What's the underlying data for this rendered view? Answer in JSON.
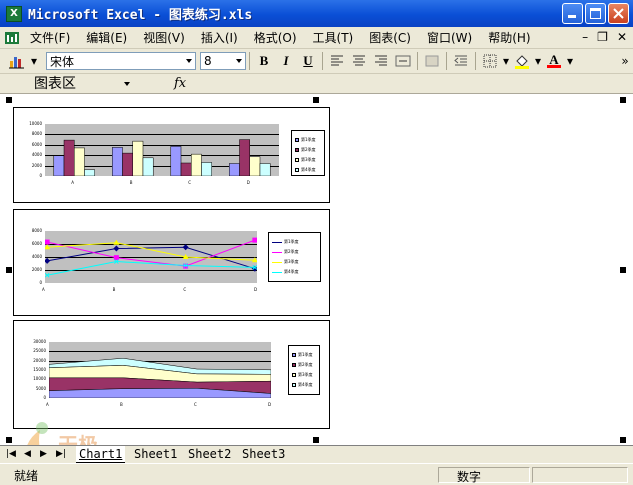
{
  "window": {
    "title": "Microsoft Excel - 图表练习.xls",
    "app_icon_letter": "X"
  },
  "menu": [
    "文件(F)",
    "编辑(E)",
    "视图(V)",
    "插入(I)",
    "格式(O)",
    "工具(T)",
    "图表(C)",
    "窗口(W)",
    "帮助(H)"
  ],
  "toolbar": {
    "font_name": "宋体",
    "font_size": "8",
    "bold": "B",
    "italic": "I",
    "underline": "U",
    "font_color_letter": "A"
  },
  "formula_bar": {
    "name_box": "图表区",
    "fx": "fx"
  },
  "sheet_tabs": [
    "Chart1",
    "Sheet1",
    "Sheet2",
    "Sheet3"
  ],
  "status": {
    "left": "就绪",
    "right": "数字"
  },
  "watermark": "天极",
  "colors": {
    "titlebar": "#0a4fd6",
    "series1": "#9999ff",
    "series2": "#993366",
    "series3": "#ffffcc",
    "series4": "#ccffff",
    "line1": "#000080",
    "line2": "#ff00ff",
    "line3": "#ffff00",
    "line4": "#00ffff"
  },
  "chart_data": [
    {
      "type": "bar",
      "categories": [
        "A",
        "B",
        "C",
        "D"
      ],
      "ylim": [
        0,
        10000
      ],
      "yticks": [
        "10000",
        "8000",
        "6000",
        "4000",
        "2000",
        "0"
      ],
      "series": [
        {
          "name": "第1季度",
          "values": [
            3900,
            5500,
            5700,
            2400
          ]
        },
        {
          "name": "第2季度",
          "values": [
            6900,
            4400,
            2500,
            7000
          ]
        },
        {
          "name": "第3季度",
          "values": [
            5400,
            6700,
            4200,
            3700
          ]
        },
        {
          "name": "第4季度",
          "values": [
            1200,
            3500,
            2600,
            2400
          ]
        }
      ]
    },
    {
      "type": "line",
      "categories": [
        "A",
        "B",
        "C",
        "D"
      ],
      "ylim": [
        0,
        8000
      ],
      "yticks": [
        "8000",
        "6000",
        "4000",
        "2000",
        "0"
      ],
      "series": [
        {
          "name": "第1季度",
          "values": [
            3400,
            5300,
            5500,
            2200
          ]
        },
        {
          "name": "第2季度",
          "values": [
            6300,
            3900,
            2600,
            6600
          ]
        },
        {
          "name": "第3季度",
          "values": [
            5500,
            6200,
            4000,
            3500
          ]
        },
        {
          "name": "第4季度",
          "values": [
            1200,
            3300,
            2700,
            2400
          ]
        }
      ]
    },
    {
      "type": "area",
      "categories": [
        "A",
        "B",
        "C",
        "D"
      ],
      "ylim": [
        0,
        30000
      ],
      "yticks": [
        "30000",
        "25000",
        "20000",
        "15000",
        "10000",
        "5000",
        "0"
      ],
      "series": [
        {
          "name": "第1季度",
          "values": [
            3900,
            5000,
            5200,
            2400
          ]
        },
        {
          "name": "第2季度",
          "values": [
            6900,
            5800,
            3300,
            6600
          ]
        },
        {
          "name": "第3季度",
          "values": [
            5400,
            6700,
            4400,
            3700
          ]
        },
        {
          "name": "第4季度",
          "values": [
            1800,
            3800,
            2600,
            2400
          ]
        }
      ]
    }
  ]
}
